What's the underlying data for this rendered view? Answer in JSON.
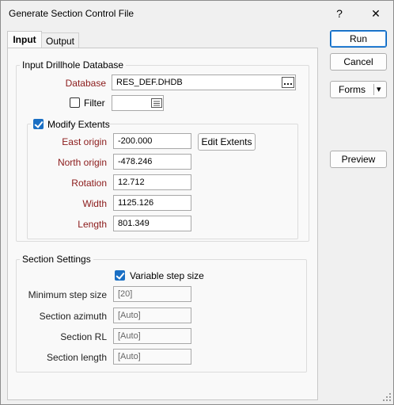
{
  "window": {
    "title": "Generate Section Control File",
    "help_glyph": "?",
    "close_glyph": "✕"
  },
  "tabs": [
    {
      "label": "Input"
    },
    {
      "label": "Output"
    }
  ],
  "drillhole_group": {
    "legend": "Input Drillhole Database",
    "database_label": "Database",
    "database_value": "RES_DEF.DHDB",
    "filter_label": "Filter",
    "filter_checked": false,
    "filter_value": ""
  },
  "extents_group": {
    "legend": "Modify Extents",
    "checked": true,
    "edit_button": "Edit Extents",
    "fields": [
      {
        "label": "East origin",
        "value": "-200.000"
      },
      {
        "label": "North origin",
        "value": "-478.246"
      },
      {
        "label": "Rotation",
        "value": "12.712"
      },
      {
        "label": "Width",
        "value": "1125.126"
      },
      {
        "label": "Length",
        "value": "801.349"
      }
    ]
  },
  "section_group": {
    "legend": "Section Settings",
    "variable_step_label": "Variable step size",
    "variable_step_checked": true,
    "fields": [
      {
        "label": "Minimum step size",
        "value": "[20]"
      },
      {
        "label": "Section azimuth",
        "value": "[Auto]"
      },
      {
        "label": "Section RL",
        "value": "[Auto]"
      },
      {
        "label": "Section length",
        "value": "[Auto]"
      }
    ]
  },
  "side_buttons": {
    "run": "Run",
    "cancel": "Cancel",
    "forms": "Forms",
    "forms_arrow": "▾",
    "preview": "Preview"
  },
  "icons": {
    "ellipsis": "ellipsis-icon",
    "list": "list-picker-icon",
    "grip": "resize-grip-icon"
  }
}
